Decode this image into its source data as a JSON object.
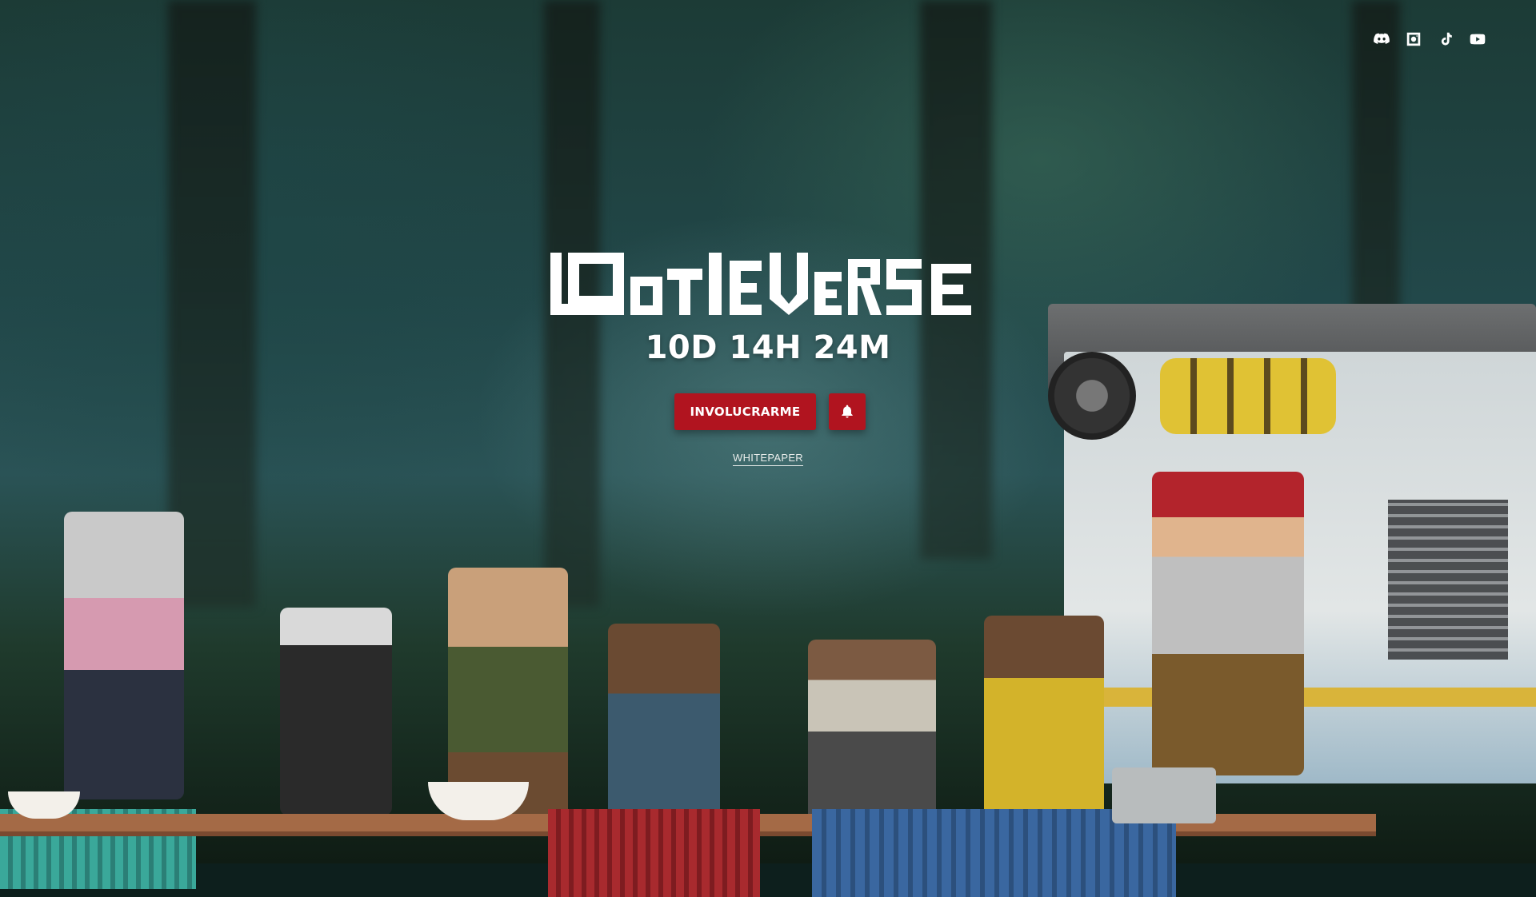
{
  "brand": {
    "logo_text": "LOOTIEVERSE"
  },
  "social": [
    {
      "name": "discord-icon"
    },
    {
      "name": "instagram-icon"
    },
    {
      "name": "tiktok-icon"
    },
    {
      "name": "youtube-icon"
    }
  ],
  "hero": {
    "countdown": "10D 14H 24M",
    "cta_label": "INVOLUCRARME",
    "whitepaper_label": "WHITEPAPER"
  },
  "colors": {
    "accent": "#b1141f",
    "text": "#ffffff"
  }
}
